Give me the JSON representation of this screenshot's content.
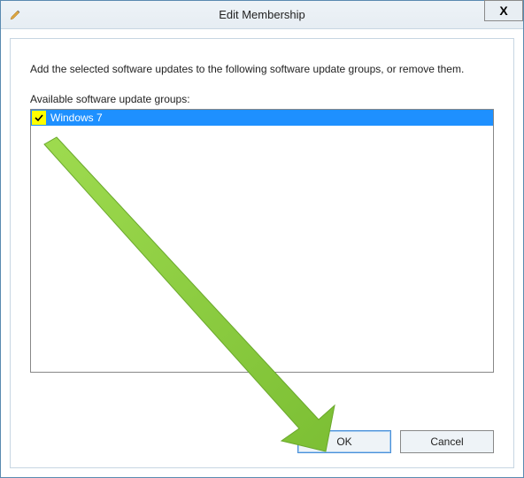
{
  "titlebar": {
    "title": "Edit Membership",
    "close_label": "X"
  },
  "content": {
    "description": "Add the selected software updates to the following software update groups, or remove them.",
    "list_label": "Available software update groups:"
  },
  "groups": [
    {
      "label": "Windows 7",
      "checked": true,
      "selected": true
    }
  ],
  "buttons": {
    "ok": "OK",
    "cancel": "Cancel"
  },
  "colors": {
    "selection": "#1e90ff",
    "highlight": "#ffff00",
    "arrow": "#8cc63f"
  }
}
